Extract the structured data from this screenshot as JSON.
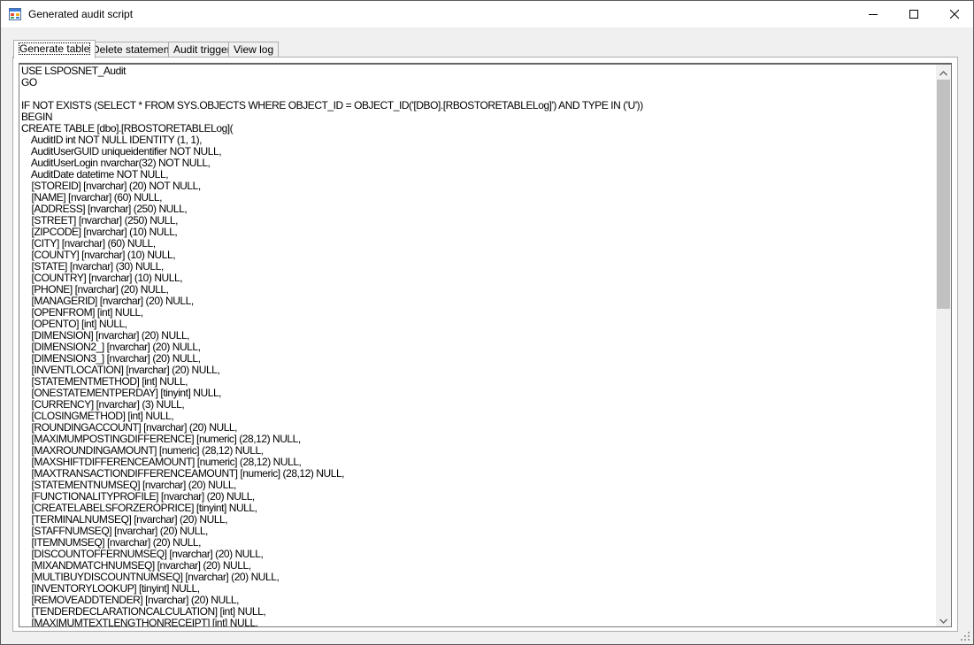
{
  "window": {
    "title": "Generated audit script"
  },
  "tabs": [
    {
      "label": "Generate table",
      "active": true
    },
    {
      "label": "Delete statement",
      "active": false
    },
    {
      "label": "Audit trigger",
      "active": false
    },
    {
      "label": "View log",
      "active": false
    }
  ],
  "script": {
    "text": "USE LSPOSNET_Audit\nGO\n\nIF NOT EXISTS (SELECT * FROM SYS.OBJECTS WHERE OBJECT_ID = OBJECT_ID('[DBO].[RBOSTORETABLELog]') AND TYPE IN ('U'))\nBEGIN\nCREATE TABLE [dbo].[RBOSTORETABLELog](\n    AuditID int NOT NULL IDENTITY (1, 1),\n    AuditUserGUID uniqueidentifier NOT NULL,\n    AuditUserLogin nvarchar(32) NOT NULL,\n    AuditDate datetime NOT NULL,\n    [STOREID] [nvarchar] (20) NOT NULL,\n    [NAME] [nvarchar] (60) NULL,\n    [ADDRESS] [nvarchar] (250) NULL,\n    [STREET] [nvarchar] (250) NULL,\n    [ZIPCODE] [nvarchar] (10) NULL,\n    [CITY] [nvarchar] (60) NULL,\n    [COUNTY] [nvarchar] (10) NULL,\n    [STATE] [nvarchar] (30) NULL,\n    [COUNTRY] [nvarchar] (10) NULL,\n    [PHONE] [nvarchar] (20) NULL,\n    [MANAGERID] [nvarchar] (20) NULL,\n    [OPENFROM] [int] NULL,\n    [OPENTO] [int] NULL,\n    [DIMENSION] [nvarchar] (20) NULL,\n    [DIMENSION2_] [nvarchar] (20) NULL,\n    [DIMENSION3_] [nvarchar] (20) NULL,\n    [INVENTLOCATION] [nvarchar] (20) NULL,\n    [STATEMENTMETHOD] [int] NULL,\n    [ONESTATEMENTPERDAY] [tinyint] NULL,\n    [CURRENCY] [nvarchar] (3) NULL,\n    [CLOSINGMETHOD] [int] NULL,\n    [ROUNDINGACCOUNT] [nvarchar] (20) NULL,\n    [MAXIMUMPOSTINGDIFFERENCE] [numeric] (28,12) NULL,\n    [MAXROUNDINGAMOUNT] [numeric] (28,12) NULL,\n    [MAXSHIFTDIFFERENCEAMOUNT] [numeric] (28,12) NULL,\n    [MAXTRANSACTIONDIFFERENCEAMOUNT] [numeric] (28,12) NULL,\n    [STATEMENTNUMSEQ] [nvarchar] (20) NULL,\n    [FUNCTIONALITYPROFILE] [nvarchar] (20) NULL,\n    [CREATELABELSFORZEROPRICE] [tinyint] NULL,\n    [TERMINALNUMSEQ] [nvarchar] (20) NULL,\n    [STAFFNUMSEQ] [nvarchar] (20) NULL,\n    [ITEMNUMSEQ] [nvarchar] (20) NULL,\n    [DISCOUNTOFFERNUMSEQ] [nvarchar] (20) NULL,\n    [MIXANDMATCHNUMSEQ] [nvarchar] (20) NULL,\n    [MULTIBUYDISCOUNTNUMSEQ] [nvarchar] (20) NULL,\n    [INVENTORYLOOKUP] [tinyint] NULL,\n    [REMOVEADDTENDER] [nvarchar] (20) NULL,\n    [TENDERDECLARATIONCALCULATION] [int] NULL,\n    [MAXIMUMTEXTLENGTHONRECEIPT] [int] NULL,"
  },
  "icons": {
    "app": "app-form-icon",
    "minimize": "minimize-icon",
    "maximize": "maximize-icon",
    "close": "close-icon",
    "scroll_up": "chevron-up-icon",
    "scroll_down": "chevron-down-icon",
    "grip": "resize-grip-icon"
  },
  "colors": {
    "window_bg": "#f0f0f0",
    "titlebar_bg": "#ffffff",
    "scroll_thumb": "#c1c1c1"
  }
}
